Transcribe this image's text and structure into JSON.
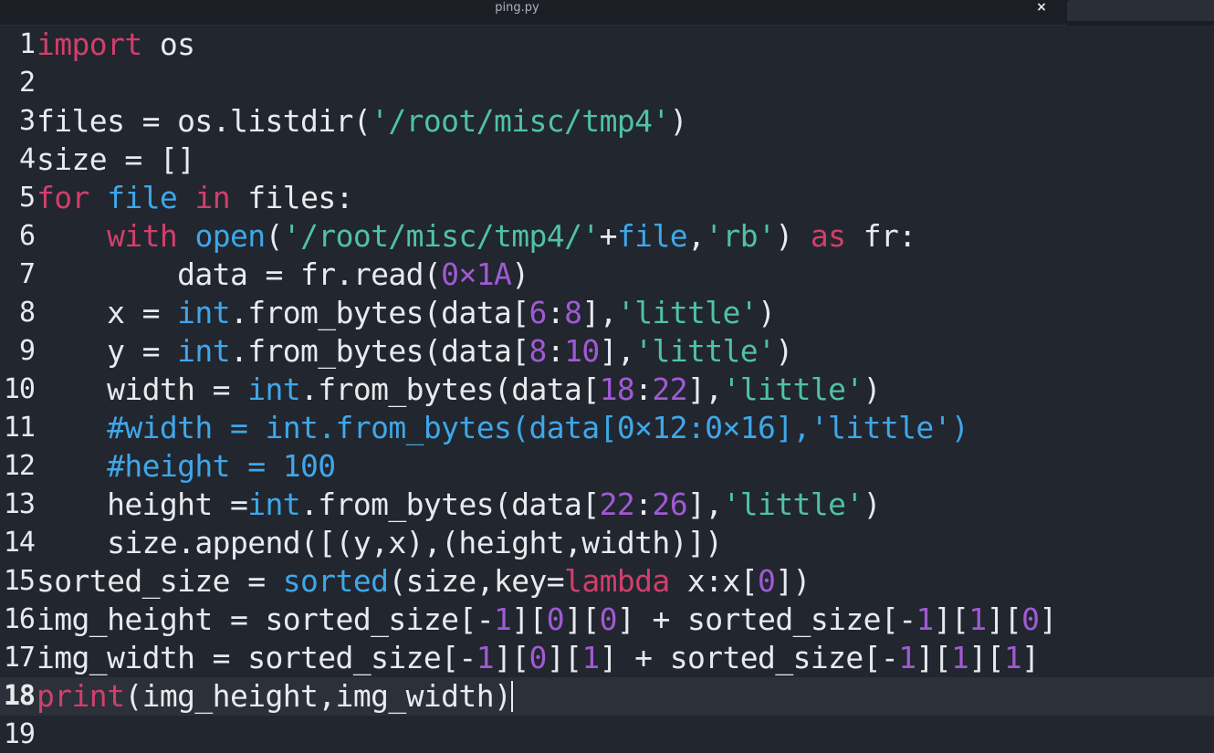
{
  "tab": {
    "title": "ping.py",
    "close_label": "×"
  },
  "colors": {
    "default": "#e8eaee",
    "keyword": "#d13f6b",
    "builtin": "#3fa7e8",
    "string": "#4fc2a5",
    "number": "#a05ad4",
    "comment": "#3fa7e8",
    "background": "#22262f",
    "current_line": "#2c3039"
  },
  "editor": {
    "current_line": 18,
    "lines": [
      {
        "num": "1",
        "tokens": [
          [
            "import",
            "keyword"
          ],
          [
            " os",
            "default"
          ]
        ]
      },
      {
        "num": "2",
        "tokens": []
      },
      {
        "num": "3",
        "tokens": [
          [
            "files = os.listdir(",
            "default"
          ],
          [
            "'/root/misc/tmp4'",
            "string"
          ],
          [
            ")",
            "default"
          ]
        ]
      },
      {
        "num": "4",
        "tokens": [
          [
            "size = []",
            "default"
          ]
        ]
      },
      {
        "num": "5",
        "tokens": [
          [
            "for",
            "keyword"
          ],
          [
            " ",
            "default"
          ],
          [
            "file",
            "builtin"
          ],
          [
            " ",
            "default"
          ],
          [
            "in",
            "keyword"
          ],
          [
            " files:",
            "default"
          ]
        ]
      },
      {
        "num": "6",
        "tokens": [
          [
            "    ",
            "default"
          ],
          [
            "with",
            "keyword"
          ],
          [
            " ",
            "default"
          ],
          [
            "open",
            "builtin"
          ],
          [
            "(",
            "default"
          ],
          [
            "'/root/misc/tmp4/'",
            "string"
          ],
          [
            "+",
            "default"
          ],
          [
            "file",
            "builtin"
          ],
          [
            ",",
            "default"
          ],
          [
            "'rb'",
            "string"
          ],
          [
            ") ",
            "default"
          ],
          [
            "as",
            "keyword"
          ],
          [
            " fr:",
            "default"
          ]
        ]
      },
      {
        "num": "7",
        "tokens": [
          [
            "        data = fr.read(",
            "default"
          ],
          [
            "0×1A",
            "number"
          ],
          [
            ")",
            "default"
          ]
        ]
      },
      {
        "num": "8",
        "tokens": [
          [
            "    x = ",
            "default"
          ],
          [
            "int",
            "builtin"
          ],
          [
            ".from_bytes(data[",
            "default"
          ],
          [
            "6",
            "number"
          ],
          [
            ":",
            "default"
          ],
          [
            "8",
            "number"
          ],
          [
            "],",
            "default"
          ],
          [
            "'little'",
            "string"
          ],
          [
            ")",
            "default"
          ]
        ]
      },
      {
        "num": "9",
        "tokens": [
          [
            "    y = ",
            "default"
          ],
          [
            "int",
            "builtin"
          ],
          [
            ".from_bytes(data[",
            "default"
          ],
          [
            "8",
            "number"
          ],
          [
            ":",
            "default"
          ],
          [
            "10",
            "number"
          ],
          [
            "],",
            "default"
          ],
          [
            "'little'",
            "string"
          ],
          [
            ")",
            "default"
          ]
        ]
      },
      {
        "num": "10",
        "tokens": [
          [
            "    width = ",
            "default"
          ],
          [
            "int",
            "builtin"
          ],
          [
            ".from_bytes(data[",
            "default"
          ],
          [
            "18",
            "number"
          ],
          [
            ":",
            "default"
          ],
          [
            "22",
            "number"
          ],
          [
            "],",
            "default"
          ],
          [
            "'little'",
            "string"
          ],
          [
            ")",
            "default"
          ]
        ]
      },
      {
        "num": "11",
        "tokens": [
          [
            "    #width = int.from_bytes(data[0×12:0×16],'little')",
            "comment"
          ]
        ]
      },
      {
        "num": "12",
        "tokens": [
          [
            "    #height = 100",
            "comment"
          ]
        ]
      },
      {
        "num": "13",
        "tokens": [
          [
            "    height =",
            "default"
          ],
          [
            "int",
            "builtin"
          ],
          [
            ".from_bytes(data[",
            "default"
          ],
          [
            "22",
            "number"
          ],
          [
            ":",
            "default"
          ],
          [
            "26",
            "number"
          ],
          [
            "],",
            "default"
          ],
          [
            "'little'",
            "string"
          ],
          [
            ")",
            "default"
          ]
        ]
      },
      {
        "num": "14",
        "tokens": [
          [
            "    size.append([(y,x),(height,width)])",
            "default"
          ]
        ]
      },
      {
        "num": "15",
        "tokens": [
          [
            "sorted_size = ",
            "default"
          ],
          [
            "sorted",
            "builtin"
          ],
          [
            "(size,key=",
            "default"
          ],
          [
            "lambda",
            "keyword"
          ],
          [
            " x:x[",
            "default"
          ],
          [
            "0",
            "number"
          ],
          [
            "])",
            "default"
          ]
        ]
      },
      {
        "num": "16",
        "tokens": [
          [
            "img_height = sorted_size[-",
            "default"
          ],
          [
            "1",
            "number"
          ],
          [
            "][",
            "default"
          ],
          [
            "0",
            "number"
          ],
          [
            "][",
            "default"
          ],
          [
            "0",
            "number"
          ],
          [
            "] + sorted_size[-",
            "default"
          ],
          [
            "1",
            "number"
          ],
          [
            "][",
            "default"
          ],
          [
            "1",
            "number"
          ],
          [
            "][",
            "default"
          ],
          [
            "0",
            "number"
          ],
          [
            "]",
            "default"
          ]
        ]
      },
      {
        "num": "17",
        "tokens": [
          [
            "img_width = sorted_size[-",
            "default"
          ],
          [
            "1",
            "number"
          ],
          [
            "][",
            "default"
          ],
          [
            "0",
            "number"
          ],
          [
            "][",
            "default"
          ],
          [
            "1",
            "number"
          ],
          [
            "] + sorted_size[-",
            "default"
          ],
          [
            "1",
            "number"
          ],
          [
            "][",
            "default"
          ],
          [
            "1",
            "number"
          ],
          [
            "][",
            "default"
          ],
          [
            "1",
            "number"
          ],
          [
            "]",
            "default"
          ]
        ]
      },
      {
        "num": "18",
        "tokens": [
          [
            "print",
            "keyword"
          ],
          [
            "(img_height,img_width)",
            "default"
          ]
        ]
      },
      {
        "num": "19",
        "tokens": []
      }
    ]
  }
}
